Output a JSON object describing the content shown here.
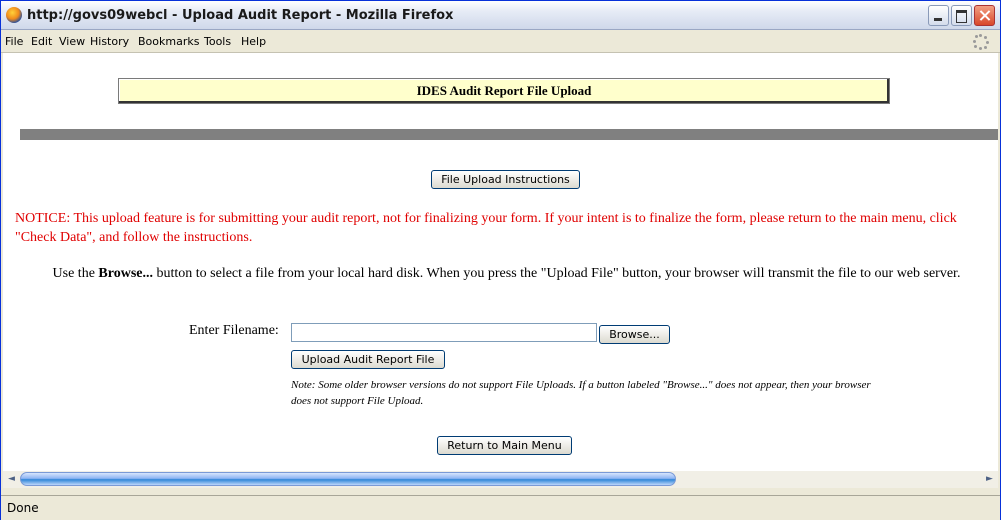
{
  "window": {
    "title": "http://govs09webcl - Upload Audit Report - Mozilla Firefox"
  },
  "menubar": {
    "items": [
      "File",
      "Edit",
      "View",
      "History",
      "Bookmarks",
      "Tools",
      "Help"
    ]
  },
  "page": {
    "banner_title": "IDES Audit Report File Upload",
    "instructions_button": "File Upload Instructions",
    "notice": "NOTICE: This upload feature is for submitting your audit report, not for finalizing your form. If your intent is to finalize the form, please return to the main menu, click \"Check Data\", and follow the instructions.",
    "instructions_pre": "Use the ",
    "instructions_bold": "Browse...",
    "instructions_post": " button to select a file from your local hard disk. When you press the \"Upload File\" button, your browser will transmit the file to our web server.",
    "filename_label": "Enter Filename:",
    "filename_value": "",
    "browse_button": "Browse...",
    "upload_button": "Upload Audit Report File",
    "note": "Note: Some older browser versions do not support File Uploads. If a button labeled \"Browse...\" does not appear, then your browser does not support File Upload.",
    "return_button": "Return to Main Menu"
  },
  "scrollbar": {
    "left_arrow": "◄",
    "right_arrow": "►"
  },
  "status": {
    "text": "Done"
  },
  "icons": {
    "app": "firefox-icon",
    "throbber": "loading-throbber-icon"
  }
}
